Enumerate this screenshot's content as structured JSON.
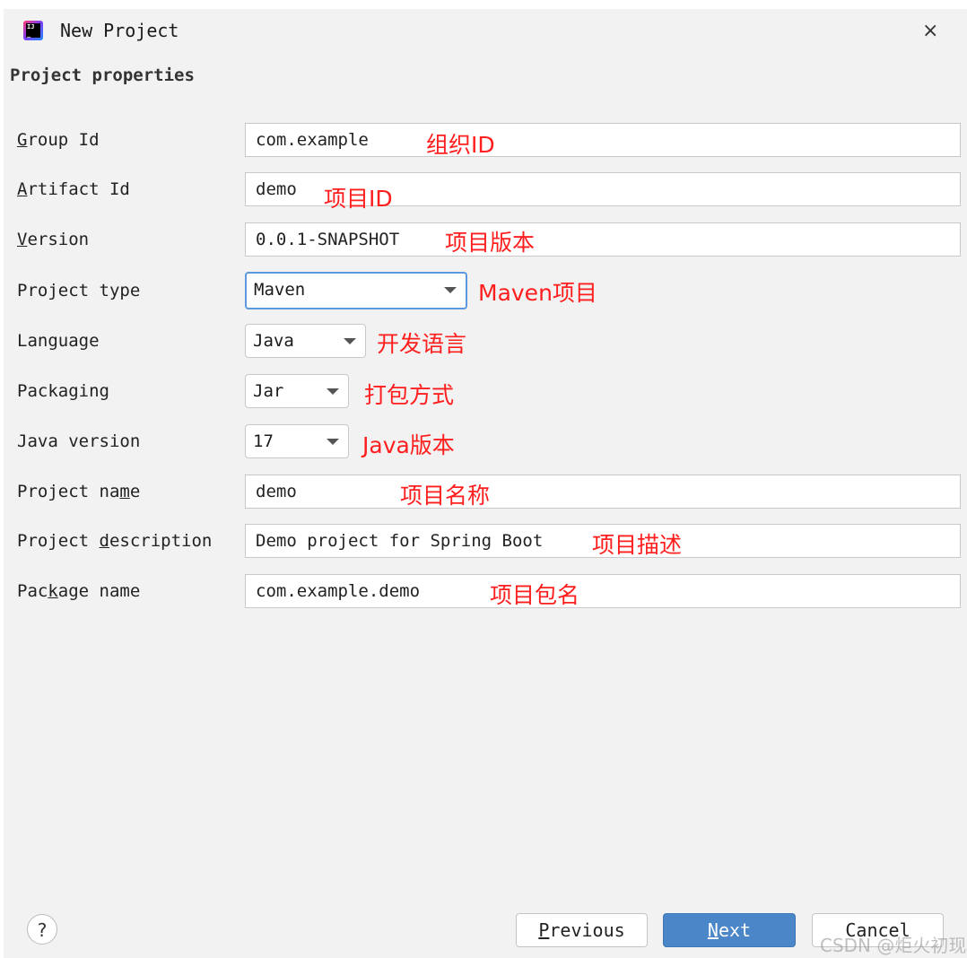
{
  "window": {
    "title": "New Project",
    "close_icon": "×"
  },
  "section_title": "Project properties",
  "fields": {
    "group_id": {
      "label_u": "G",
      "label_rest": "roup Id",
      "value": "com.example",
      "note": "组织ID"
    },
    "artifact_id": {
      "label_u": "A",
      "label_rest": "rtifact Id",
      "value": "demo",
      "note": "项目ID"
    },
    "version": {
      "label_u": "V",
      "label_rest": "ersion",
      "value": "0.0.1-SNAPSHOT",
      "note": "项目版本"
    },
    "project_type": {
      "label": "Project type",
      "value": "Maven",
      "note": "Maven项目"
    },
    "language": {
      "label": "Language",
      "value": "Java",
      "note": "开发语言"
    },
    "packaging": {
      "label": "Packaging",
      "value": "Jar",
      "note": "打包方式"
    },
    "java_version": {
      "label": "Java version",
      "value": "17",
      "note": "Java版本"
    },
    "project_name": {
      "label_pre": "Project na",
      "label_u": "m",
      "label_rest": "e",
      "value": "demo",
      "note": "项目名称"
    },
    "project_description": {
      "label_pre": "Project ",
      "label_u": "d",
      "label_rest": "escription",
      "value": "Demo project for Spring Boot",
      "note": "项目描述"
    },
    "package_name": {
      "label_pre": "Pac",
      "label_u": "k",
      "label_rest": "age name",
      "value": "com.example.demo",
      "note": "项目包名"
    }
  },
  "buttons": {
    "help": "?",
    "previous_u": "P",
    "previous_rest": "revious",
    "next_u": "N",
    "next_rest": "ext",
    "cancel": "Cancel"
  },
  "watermark": "CSDN @炬火初现"
}
